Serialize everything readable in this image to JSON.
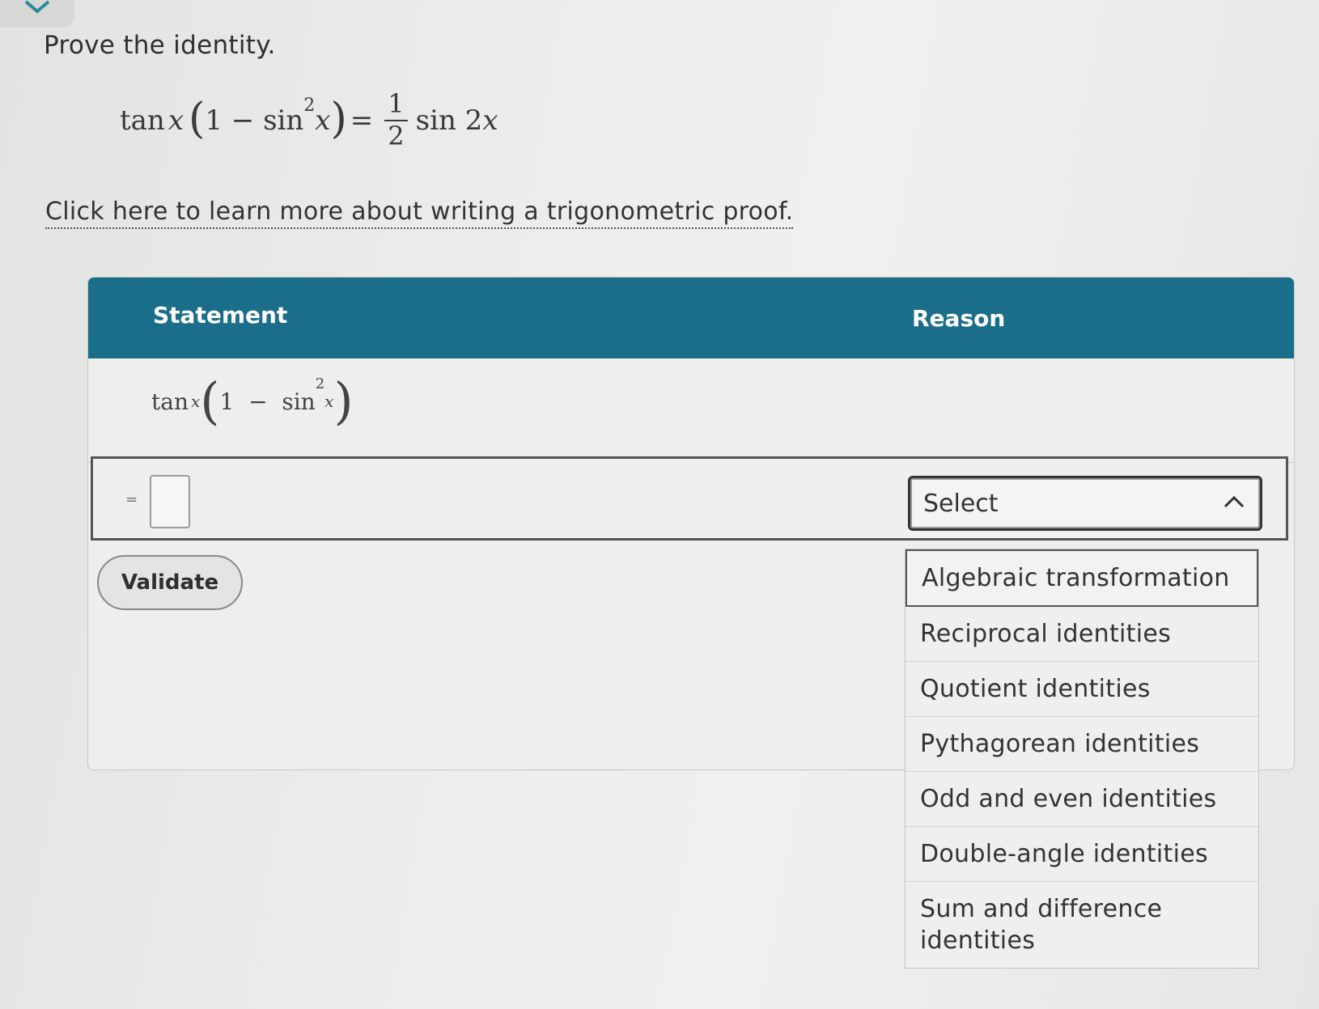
{
  "prompt": "Prove the identity.",
  "identity": {
    "lhs_func": "tan",
    "lhs_var": "x",
    "paren_open": "(",
    "one_minus": "1 − sin",
    "exp": "2",
    "inner_var": "x",
    "paren_close": ")",
    "equals": "=",
    "frac_num": "1",
    "frac_den": "2",
    "rhs": "sin 2",
    "rhs_var": "x"
  },
  "help_link": "Click here to learn more about writing a trigonometric proof.",
  "table": {
    "header_statement": "Statement",
    "header_reason": "Reason",
    "row1": {
      "func": "tan",
      "var": "x",
      "paren_open": "(",
      "one_minus": "1  −  sin",
      "exp": "2",
      "inner_var": "x",
      "paren_close": ")"
    },
    "active_row": {
      "equals": "="
    }
  },
  "select": {
    "label": "Select",
    "icon": "chevron-up-icon"
  },
  "validate_label": "Validate",
  "dropdown_options": [
    "Algebraic transformation",
    "Reciprocal identities",
    "Quotient identities",
    "Pythagorean identities",
    "Odd and even identities",
    "Double-angle identities",
    "Sum and difference identities"
  ],
  "colors": {
    "header_bg": "#1b6e8a",
    "header_text": "#ffffff"
  }
}
